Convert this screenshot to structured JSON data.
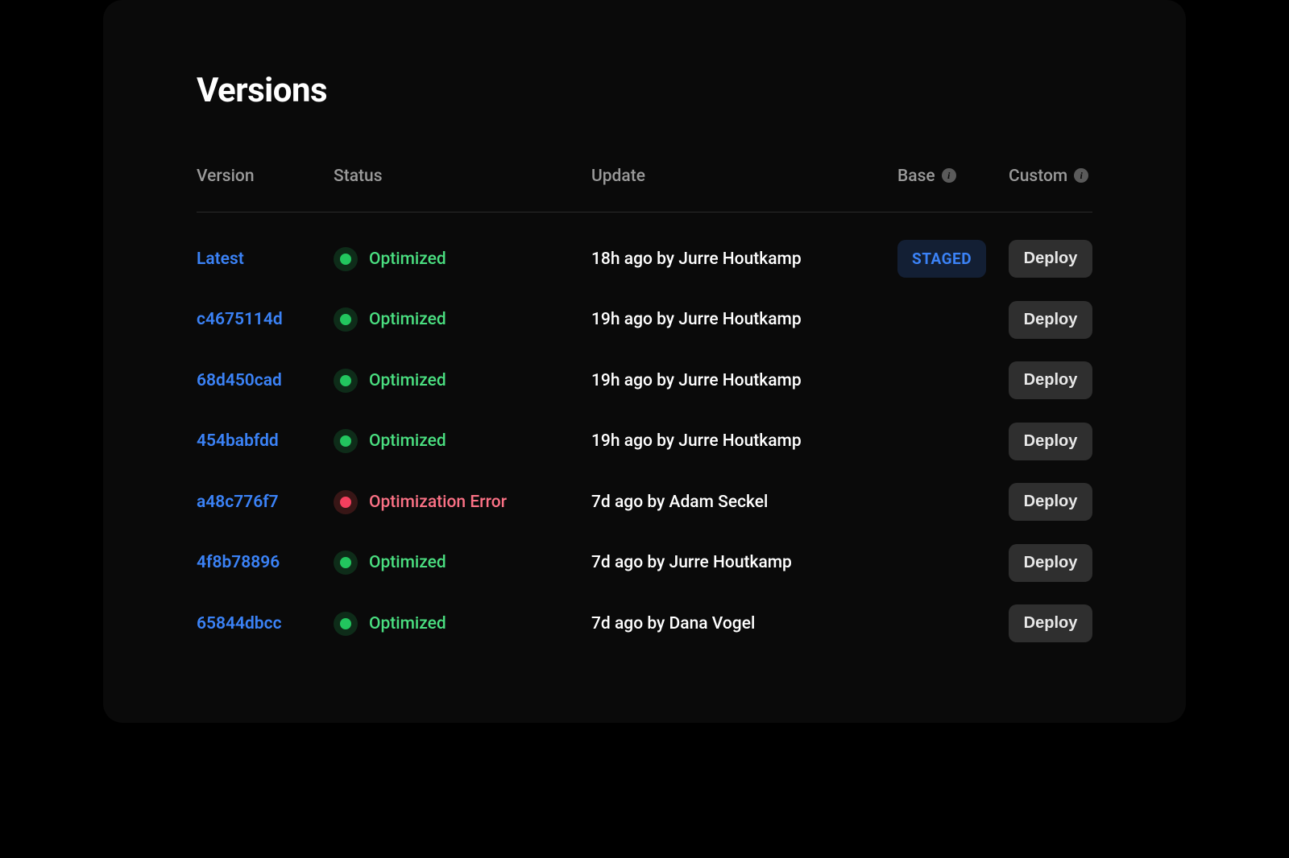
{
  "title": "Versions",
  "columns": {
    "version": "Version",
    "status": "Status",
    "update": "Update",
    "base": "Base",
    "custom": "Custom"
  },
  "status_labels": {
    "optimized": "Optimized",
    "error": "Optimization Error"
  },
  "badges": {
    "staged": "STAGED"
  },
  "buttons": {
    "deploy": "Deploy"
  },
  "rows": [
    {
      "version": "Latest",
      "status": "optimized",
      "update": "18h ago by Jurre Houtkamp",
      "base_staged": true
    },
    {
      "version": "c4675114d",
      "status": "optimized",
      "update": "19h ago by Jurre Houtkamp",
      "base_staged": false
    },
    {
      "version": "68d450cad",
      "status": "optimized",
      "update": "19h ago by Jurre Houtkamp",
      "base_staged": false
    },
    {
      "version": "454babfdd",
      "status": "optimized",
      "update": "19h ago by Jurre Houtkamp",
      "base_staged": false
    },
    {
      "version": "a48c776f7",
      "status": "error",
      "update": "7d ago by Adam Seckel",
      "base_staged": false
    },
    {
      "version": "4f8b78896",
      "status": "optimized",
      "update": "7d ago by Jurre Houtkamp",
      "base_staged": false
    },
    {
      "version": "65844dbcc",
      "status": "optimized",
      "update": "7d ago by Dana Vogel",
      "base_staged": false
    }
  ]
}
